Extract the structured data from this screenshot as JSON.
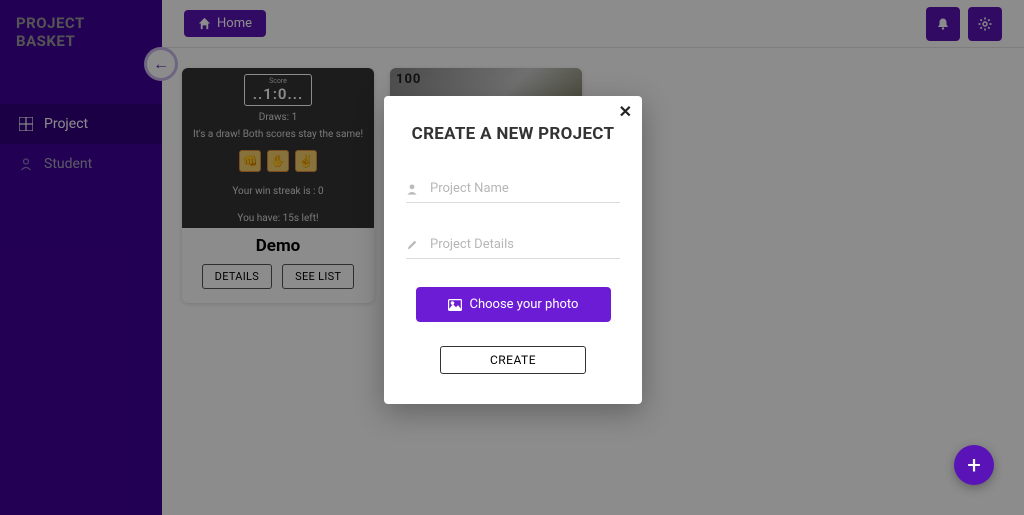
{
  "brand": "PROJECT BASKET",
  "sidebar": {
    "items": [
      {
        "label": "Project"
      },
      {
        "label": "Student"
      }
    ]
  },
  "topbar": {
    "home_label": "Home"
  },
  "card1": {
    "score_label": "Score",
    "score_value": "..1:0...",
    "draws": "Draws: 1",
    "result_msg": "It's a draw! Both scores stay the same!",
    "streak": "Your win streak is : 0",
    "timer": "You have: 15s left!",
    "title": "Demo",
    "details_btn": "DETAILS",
    "seelist_btn": "SEE LIST"
  },
  "card2": {
    "overlay_text": "100"
  },
  "modal": {
    "title": "CREATE A NEW PROJECT",
    "name_placeholder": "Project Name",
    "details_placeholder": "Project Details",
    "photo_btn": "Choose your photo",
    "create_btn": "CREATE"
  },
  "fab_label": "+"
}
